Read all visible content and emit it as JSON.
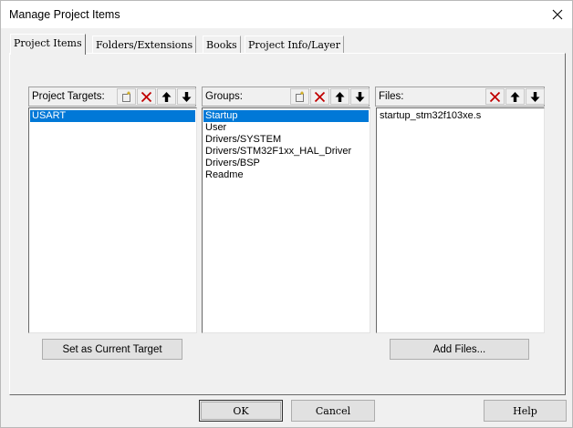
{
  "window": {
    "title": "Manage Project Items"
  },
  "tabs": [
    {
      "label": "Project Items"
    },
    {
      "label": "Folders/Extensions"
    },
    {
      "label": "Books"
    },
    {
      "label": "Project Info/Layer"
    }
  ],
  "targets": {
    "label": "Project Targets:",
    "items": [
      "USART"
    ],
    "selected_index": 0,
    "set_current_button": "Set as Current Target"
  },
  "groups": {
    "label": "Groups:",
    "items": [
      "Startup",
      "User",
      "Drivers/SYSTEM",
      "Drivers/STM32F1xx_HAL_Driver",
      "Drivers/BSP",
      "Readme"
    ],
    "selected_index": 0
  },
  "files": {
    "label": "Files:",
    "items": [
      "startup_stm32f103xe.s"
    ],
    "add_files_button": "Add Files..."
  },
  "footer": {
    "ok": "OK",
    "cancel": "Cancel",
    "help": "Help"
  },
  "icons": {
    "new": "new-item-icon",
    "delete": "delete-icon",
    "up": "move-up-icon",
    "down": "move-down-icon",
    "close": "close-icon"
  },
  "colors": {
    "selection": "#0078d7",
    "delete": "#c00000"
  }
}
